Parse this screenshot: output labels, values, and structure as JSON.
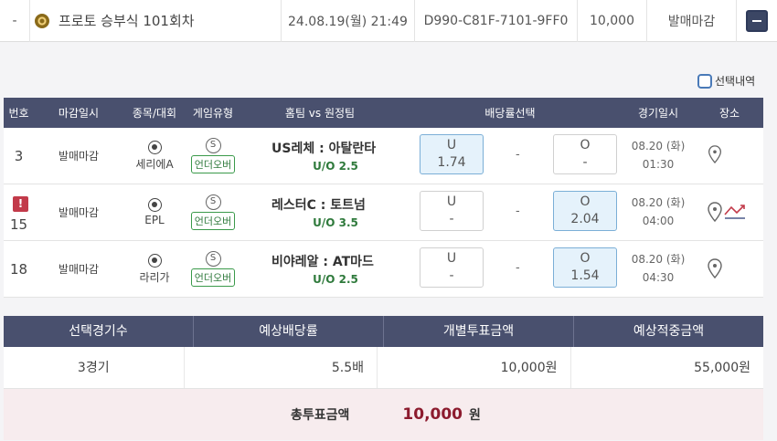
{
  "top_row": {
    "dash": "-",
    "title": "프로토 승부식 101회차",
    "datetime": "24.08.19(월) 21:49",
    "ticket_id": "D990-C81F-7101-9FF0",
    "amount": "10,000",
    "status": "발매마감",
    "collapse_icon": "minus-icon"
  },
  "select_history_label": "선택내역",
  "table": {
    "headers": [
      "번호",
      "마감일시",
      "종목/대회",
      "게임유형",
      "홈팀 vs 원정팀",
      "배당률선택",
      "경기일시",
      "장소"
    ],
    "rows": [
      {
        "no": "3",
        "deadline": "발매마감",
        "league": "세리에A",
        "type_badge": "S",
        "type_label": "언더오버",
        "match": "US레체 : 아탈란타",
        "line": "U/O 2.5",
        "under_label": "U",
        "under_odds": "1.74",
        "mid": "-",
        "over_label": "O",
        "over_odds": "-",
        "date": "08.20 (화)",
        "time": "01:30",
        "alert": false
      },
      {
        "no": "15",
        "deadline": "발매마감",
        "league": "EPL",
        "type_badge": "S",
        "type_label": "언더오버",
        "match": "레스터C : 토트넘",
        "line": "U/O 3.5",
        "under_label": "U",
        "under_odds": "-",
        "mid": "-",
        "over_label": "O",
        "over_odds": "2.04",
        "date": "08.20 (화)",
        "time": "04:00",
        "alert": true,
        "alert_text": "!"
      },
      {
        "no": "18",
        "deadline": "발매마감",
        "league": "라리가",
        "type_badge": "S",
        "type_label": "언더오버",
        "match": "비야레알 : AT마드",
        "line": "U/O 2.5",
        "under_label": "U",
        "under_odds": "-",
        "mid": "-",
        "over_label": "O",
        "over_odds": "1.54",
        "date": "08.20 (화)",
        "time": "04:30",
        "alert": false
      }
    ]
  },
  "summary": {
    "headers": [
      "선택경기수",
      "예상배당률",
      "개별투표금액",
      "예상적중금액"
    ],
    "values": [
      "3경기",
      "5.5배",
      "10,000원",
      "55,000원"
    ],
    "total_label": "총투표금액",
    "total_amount": "10,000",
    "total_unit": "원"
  },
  "colors": {
    "header_bg": "#49506e",
    "selected_odds": "#e5f2fb",
    "total_amount": "#8c1b2e",
    "uo_green": "#2f7a3c"
  }
}
